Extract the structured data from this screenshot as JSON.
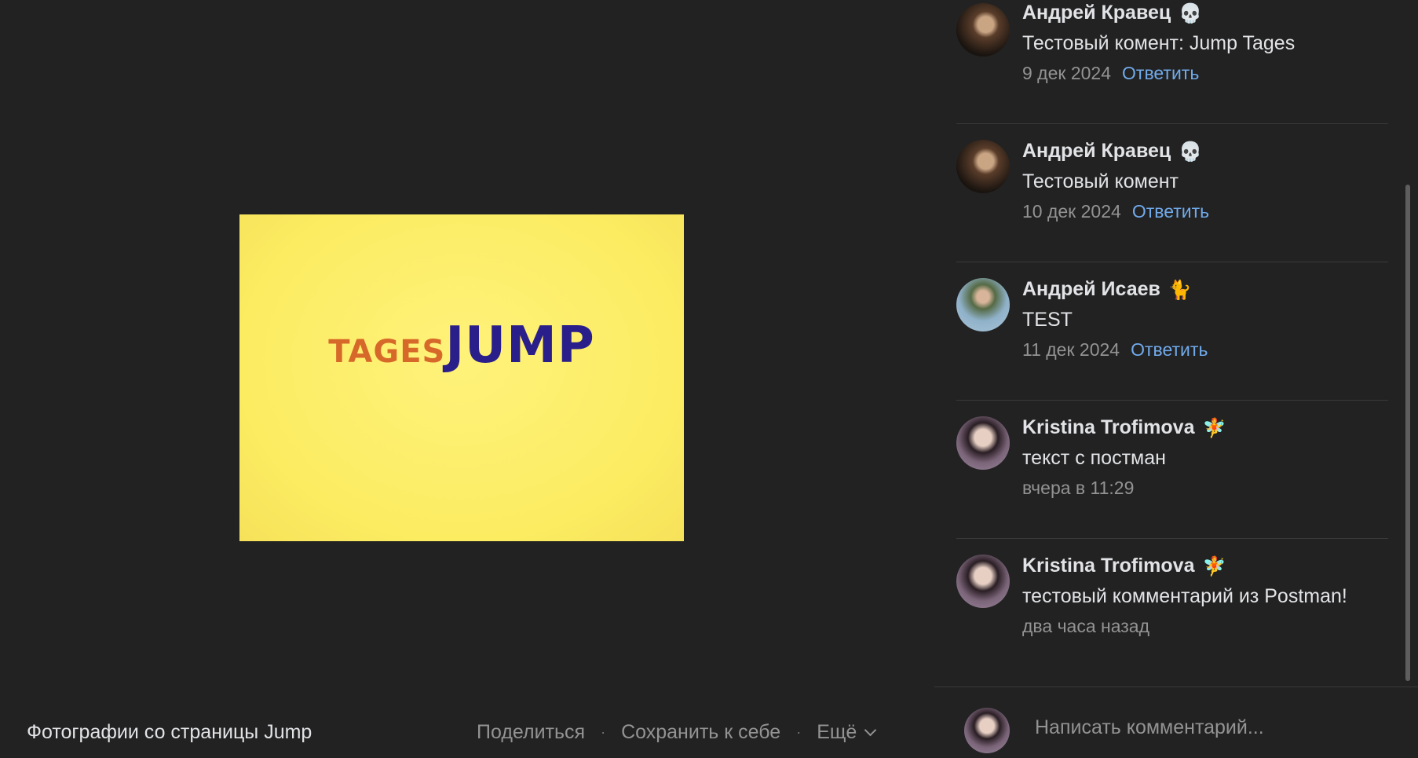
{
  "photo": {
    "logo_left": "TAGES",
    "logo_right": "JUMP",
    "accent_bg": "#fdf06c"
  },
  "footer": {
    "album_title": "Фотографии со страницы Jump",
    "share_label": "Поделиться",
    "save_label": "Сохранить к себе",
    "more_label": "Ещё",
    "separator": "·"
  },
  "comments": [
    {
      "author": "Андрей Кравец",
      "emoji": "💀",
      "text": "Тестовый комент: Jump Tages",
      "date": "9 дек 2024",
      "reply": "Ответить"
    },
    {
      "author": "Андрей Кравец",
      "emoji": "💀",
      "text": "Тестовый комент",
      "date": "10 дек 2024",
      "reply": "Ответить"
    },
    {
      "author": "Андрей Исаев",
      "emoji": "🐈",
      "text": "TEST",
      "date": "11 дек 2024",
      "reply": "Ответить"
    },
    {
      "author": "Kristina Trofimova",
      "emoji": "🧚",
      "text": "текст с постман",
      "date": "вчера в 11:29",
      "reply": ""
    },
    {
      "author": "Kristina Trofimova",
      "emoji": "🧚",
      "text": "тестовый комментарий из Postman!",
      "date": "два часа назад",
      "reply": ""
    }
  ],
  "composer": {
    "placeholder": "Написать комментарий..."
  },
  "colors": {
    "background": "#222222",
    "text": "#e1e3e6",
    "muted": "#939393",
    "link": "#71aaeb"
  }
}
